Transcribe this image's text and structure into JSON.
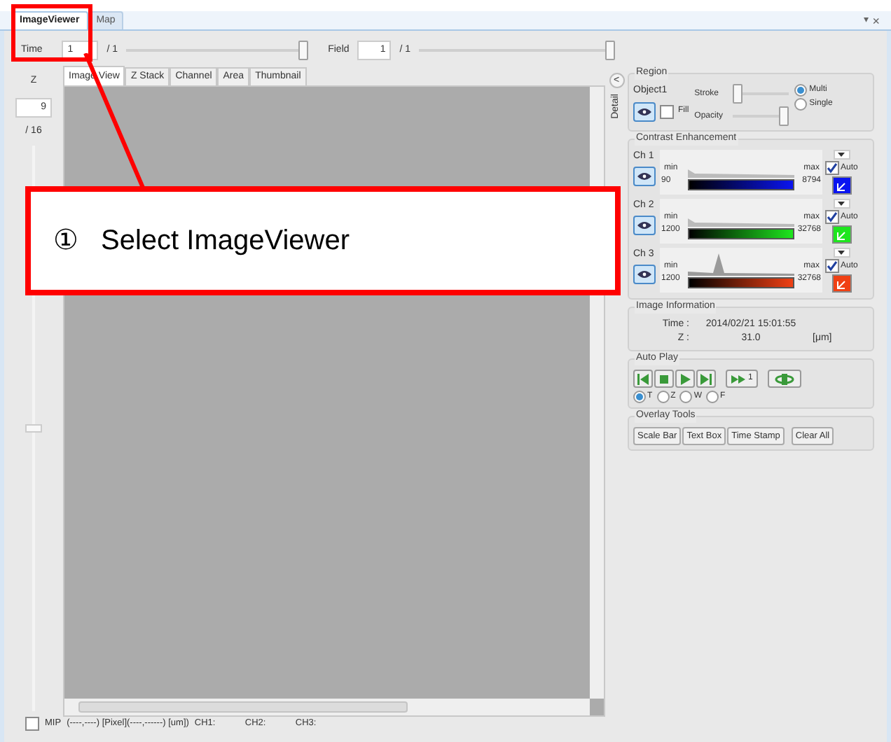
{
  "document_tabs": [
    {
      "label": "ImageViewer",
      "selected": true
    },
    {
      "label": "Map",
      "selected": false
    }
  ],
  "window_controls": [
    "▾",
    "×"
  ],
  "time": {
    "label": "Time",
    "value": "1",
    "total": "/ 1",
    "level": 1
  },
  "field": {
    "label": "Field",
    "value": "1",
    "total": "/ 1",
    "level": 1
  },
  "z": {
    "label": "Z",
    "value": "9",
    "total": "/ 16",
    "level": 0.5
  },
  "view_tabs": [
    {
      "label": "Image View",
      "selected": true
    },
    {
      "label": "Z Stack",
      "selected": false
    },
    {
      "label": "Channel",
      "selected": false
    },
    {
      "label": "Area",
      "selected": false
    },
    {
      "label": "Thumbnail",
      "selected": false
    }
  ],
  "detail": {
    "button": "<",
    "label": "Detail"
  },
  "region": {
    "title": "Region",
    "object": "Object1",
    "fill": {
      "label": "Fill",
      "checked": false
    },
    "stroke": {
      "label": "Stroke",
      "level": 0
    },
    "opacity": {
      "label": "Opacity",
      "level": 1
    },
    "modes": [
      {
        "label": "Multi",
        "selected": true
      },
      {
        "label": "Single",
        "selected": false
      }
    ]
  },
  "contrast": {
    "title": "Contrast Enhancement",
    "channels": [
      {
        "name": "Ch 1",
        "min_label": "min",
        "min": "90",
        "max_label": "max",
        "max": "8794",
        "auto": {
          "label": "Auto",
          "checked": true
        },
        "color": "#0a14f0",
        "kind": "low"
      },
      {
        "name": "Ch 2",
        "min_label": "min",
        "min": "1200",
        "max_label": "max",
        "max": "32768",
        "auto": {
          "label": "Auto",
          "checked": true
        },
        "color": "#1ee61e",
        "kind": "low"
      },
      {
        "name": "Ch 3",
        "min_label": "min",
        "min": "1200",
        "max_label": "max",
        "max": "32768",
        "auto": {
          "label": "Auto",
          "checked": true
        },
        "color": "#f04014",
        "kind": "peak"
      }
    ]
  },
  "image_info": {
    "title": "Image Information",
    "rows": [
      {
        "label": "Time :",
        "value": "2014/02/21 15:01:55"
      },
      {
        "label": "Z :",
        "value": "31.0",
        "unit": "[μm]"
      }
    ]
  },
  "auto_play": {
    "title": "Auto Play",
    "step": "1",
    "axes": [
      {
        "label": "T",
        "selected": true
      },
      {
        "label": "Z",
        "selected": false
      },
      {
        "label": "W",
        "selected": false
      },
      {
        "label": "F",
        "selected": false
      }
    ]
  },
  "overlay_tools": {
    "title": "Overlay Tools",
    "buttons": [
      "Scale Bar",
      "Text Box",
      "Time Stamp",
      "Clear All"
    ]
  },
  "status": {
    "mip": {
      "label": "MIP",
      "checked": false
    },
    "coordinates": "(----,----) [Pixel](----,------) [um])",
    "channels": [
      "CH1:",
      "CH2:",
      "CH3:"
    ]
  },
  "callout": {
    "number": "①",
    "text": "Select ImageViewer"
  }
}
